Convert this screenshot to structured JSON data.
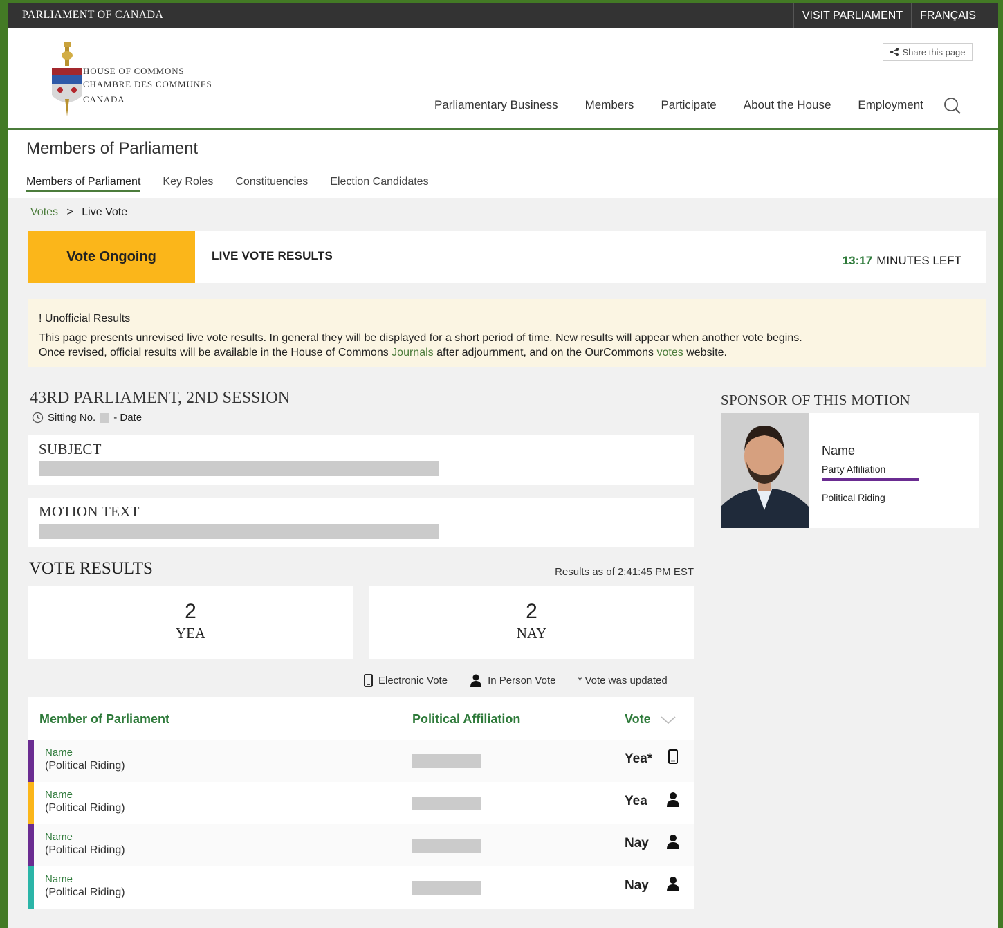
{
  "topbar": {
    "brand": "PARLIAMENT OF CANADA",
    "links": [
      "VISIT PARLIAMENT",
      "FRANÇAIS"
    ]
  },
  "logo": {
    "line1": "HOUSE OF COMMONS",
    "line2": "CHAMBRE DES COMMUNES",
    "line3": "CANADA"
  },
  "share_label": "Share this page",
  "main_nav": [
    "Parliamentary Business",
    "Members",
    "Participate",
    "About the House",
    "Employment"
  ],
  "page_title": "Members of Parliament",
  "sub_nav": [
    "Members of Parliament",
    "Key Roles",
    "Constituencies",
    "Election Candidates"
  ],
  "breadcrumb": {
    "link": "Votes",
    "sep": ">",
    "current": "Live Vote"
  },
  "status": {
    "badge": "Vote Ongoing",
    "title": "LIVE VOTE RESULTS",
    "time": "13:17",
    "time_suffix": "MINUTES LEFT"
  },
  "alert": {
    "title": "! Unofficial Results",
    "line1": "This page presents unrevised live vote results. In general they will be displayed for a short period of time. New results will appear when another vote begins.",
    "line2_a": "Once revised, official results will be available in the House of Commons",
    "journals_link": "Journals",
    "line2_b": "after adjournment, and on the OurCommons",
    "votes_link": "votes",
    "line2_c": "website."
  },
  "parliament": {
    "title": "43RD PARLIAMENT, 2ND SESSION",
    "sitting_prefix": "Sitting No.",
    "sitting_suffix": "- Date"
  },
  "subject_label": "SUBJECT",
  "motion_label": "MOTION TEXT",
  "results": {
    "title": "VOTE RESULTS",
    "as_of": "Results as of 2:41:45 PM EST",
    "yea_count": "2",
    "yea_label": "YEA",
    "nay_count": "2",
    "nay_label": "NAY"
  },
  "legend": {
    "electronic": "Electronic Vote",
    "in_person": "In Person Vote",
    "updated": "* Vote was updated"
  },
  "table": {
    "headers": [
      "Member of Parliament",
      "Political Affiliation",
      "Vote"
    ],
    "rows": [
      {
        "name": "Name",
        "riding": "(Political Riding)",
        "vote": "Yea*",
        "method": "electronic",
        "color": "#6a2c91"
      },
      {
        "name": "Name",
        "riding": "(Political Riding)",
        "vote": "Yea",
        "method": "in-person",
        "color": "#fbb61a"
      },
      {
        "name": "Name",
        "riding": "(Political Riding)",
        "vote": "Nay",
        "method": "in-person",
        "color": "#6a2c91"
      },
      {
        "name": "Name",
        "riding": "(Political Riding)",
        "vote": "Nay",
        "method": "in-person",
        "color": "#2bb5a8"
      }
    ]
  },
  "sponsor": {
    "title": "SPONSOR OF THIS MOTION",
    "name": "Name",
    "party": "Party Affiliation",
    "riding": "Political Riding"
  },
  "colors": {
    "accent_green": "#4b7c3b",
    "ongoing_yellow": "#fbb61a",
    "party_purple": "#6a2c91",
    "party_teal": "#2bb5a8"
  }
}
